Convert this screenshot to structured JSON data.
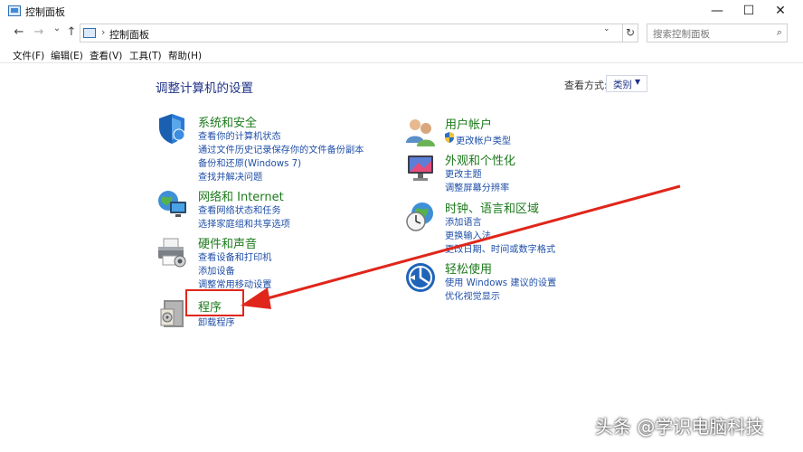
{
  "window": {
    "title": "控制面板",
    "minimize_glyph": "—",
    "maximize_glyph": "☐",
    "close_glyph": "✕"
  },
  "nav": {
    "back_glyph": "←",
    "forward_glyph": "→",
    "recent_glyph": "⌄",
    "up_glyph": "↑",
    "address_sep": "›",
    "address_text": "控制面板",
    "address_drop_glyph": "⌄",
    "refresh_glyph": "↻",
    "search_placeholder": "搜索控制面板",
    "search_glyph": "⌕"
  },
  "menu": [
    {
      "label": "文件(F)"
    },
    {
      "label": "编辑(E)"
    },
    {
      "label": "查看(V)"
    },
    {
      "label": "工具(T)"
    },
    {
      "label": "帮助(H)"
    }
  ],
  "content": {
    "heading": "调整计算机的设置",
    "view_by_label": "查看方式:",
    "view_by_value": "类别",
    "view_by_arrow": "▼"
  },
  "categories": {
    "system": {
      "title": "系统和安全",
      "icon": "shield-icon",
      "links": [
        "查看你的计算机状态",
        "通过文件历史记录保存你的文件备份副本",
        "备份和还原(Windows 7)",
        "查找并解决问题"
      ]
    },
    "network": {
      "title": "网络和 Internet",
      "icon": "globe-network-icon",
      "links": [
        "查看网络状态和任务",
        "选择家庭组和共享选项"
      ]
    },
    "hardware": {
      "title": "硬件和声音",
      "icon": "printer-icon",
      "links": [
        "查看设备和打印机",
        "添加设备",
        "调整常用移动设置"
      ]
    },
    "programs": {
      "title": "程序",
      "icon": "programs-icon",
      "links": [
        "卸载程序"
      ]
    },
    "users": {
      "title": "用户帐户",
      "icon": "users-icon",
      "links": [
        "更改帐户类型"
      ]
    },
    "appearance": {
      "title": "外观和个性化",
      "icon": "monitor-icon",
      "links": [
        "更改主题",
        "调整屏幕分辨率"
      ]
    },
    "clock": {
      "title": "时钟、语言和区域",
      "icon": "clock-globe-icon",
      "links": [
        "添加语言",
        "更换输入法",
        "更改日期、时间或数字格式"
      ]
    },
    "ease": {
      "title": "轻松使用",
      "icon": "ease-of-access-icon",
      "links": [
        "使用 Windows 建议的设置",
        "优化视觉显示"
      ]
    }
  },
  "watermark": "头条 @学识电脑科技",
  "colors": {
    "category_title": "#1c7a1c",
    "link": "#1f4fa8",
    "heading": "#1e3287",
    "annotation_red": "#e0261b"
  }
}
